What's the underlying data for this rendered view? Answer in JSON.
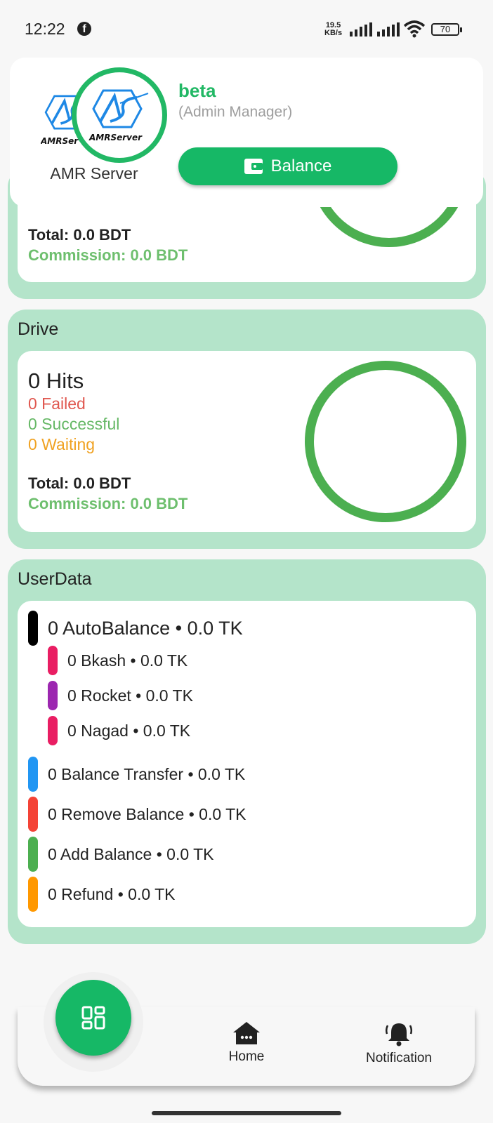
{
  "status_bar": {
    "time": "12:22",
    "net_speed_value": "19.5",
    "net_speed_unit": "KB/s",
    "battery": "70"
  },
  "header": {
    "logo_word": "AMRServer",
    "logo_word_back": "AMRSer",
    "app_name": "AMR Server",
    "user_name": "beta",
    "user_role": "(Admin Manager)",
    "balance_label": "Balance"
  },
  "sections": {
    "first": {
      "total": "Total: 0.0 BDT",
      "commission": "Commission: 0.0 BDT"
    },
    "drive": {
      "title": "Drive",
      "hits": "0 Hits",
      "failed": "0 Failed",
      "successful": "0 Successful",
      "waiting": "0 Waiting",
      "total": "Total: 0.0 BDT",
      "commission": "Commission: 0.0 BDT"
    },
    "userdata": {
      "title": "UserData",
      "items": [
        {
          "label": "0 AutoBalance • 0.0 TK",
          "color": "#000000"
        },
        {
          "label": "0 Bkash • 0.0 TK",
          "color": "#e91e63"
        },
        {
          "label": "0 Rocket • 0.0 TK",
          "color": "#9c27b0"
        },
        {
          "label": "0 Nagad • 0.0 TK",
          "color": "#e91e63"
        },
        {
          "label": "0 Balance Transfer • 0.0 TK",
          "color": "#2196f3"
        },
        {
          "label": "0 Remove Balance • 0.0 TK",
          "color": "#f44336"
        },
        {
          "label": "0 Add Balance • 0.0 TK",
          "color": "#4caf50"
        },
        {
          "label": "0 Refund • 0.0 TK",
          "color": "#ff9800"
        }
      ]
    }
  },
  "bottom_nav": {
    "home_label": "Home",
    "notification_label": "Notification",
    "fab_icon": "dashboard-icon"
  },
  "colors": {
    "accent": "#16b866",
    "section_bg": "#b4e4ca",
    "ring": "#4caf50"
  }
}
